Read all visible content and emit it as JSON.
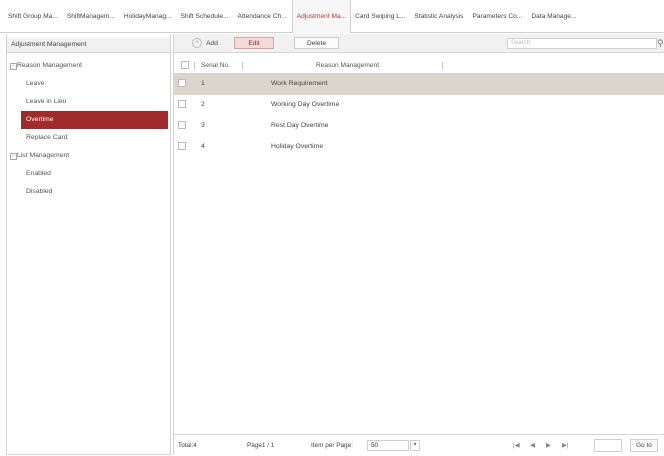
{
  "tabs": [
    {
      "label": "Shift Group Ma..."
    },
    {
      "label": "ShiftManagem..."
    },
    {
      "label": "HolidayManag..."
    },
    {
      "label": "Shift Schedule..."
    },
    {
      "label": "Attendance Ch..."
    },
    {
      "label": "Adjustment Ma..."
    },
    {
      "label": "Card Swiping L..."
    },
    {
      "label": "Statistic Analysis"
    },
    {
      "label": "Parameters Co..."
    },
    {
      "label": "Data Manage..."
    }
  ],
  "sidebar": {
    "header": "Adjustment Management",
    "reason_group": "Reason Management",
    "items": [
      "Leave",
      "Leave in Lieu",
      "Overtime",
      "Replace Card"
    ],
    "list_group": "List Management",
    "list_items": [
      "Enabled",
      "Disabled"
    ],
    "expand_symbol": "−"
  },
  "toolbar": {
    "add_label": "Add",
    "add_symbol": "+",
    "edit_label": "Edit",
    "delete_label": "Delete",
    "search_placeholder": "Search",
    "search_symbol": "⚲"
  },
  "table": {
    "col_serial": "Serial No.",
    "col_reason": "Reason Management",
    "rows": [
      {
        "serial": "1",
        "reason": "Work Requirement"
      },
      {
        "serial": "2",
        "reason": "Working Day Overtime"
      },
      {
        "serial": "3",
        "reason": "Rest Day Overtime"
      },
      {
        "serial": "4",
        "reason": "Holiday Overtime"
      }
    ]
  },
  "footer": {
    "total": "Total:4",
    "page": "Page1 / 1",
    "ipp_label": "Item per Page:",
    "ipp_value": "50",
    "ipp_arrow": "▾",
    "nav_first": "|◀",
    "nav_prev": "◀",
    "nav_next": "▶",
    "nav_last": "▶|",
    "goto_label": "Go to"
  }
}
